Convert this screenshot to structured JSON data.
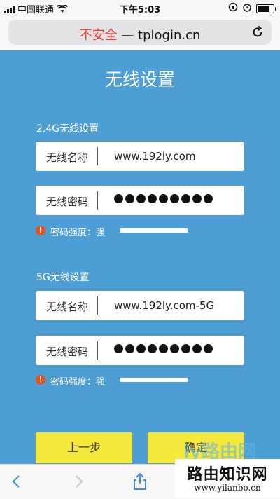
{
  "status_bar": {
    "carrier": "中国联通",
    "time": "下午5:03"
  },
  "url_bar": {
    "insecure_label": "不安全",
    "separator": "—",
    "domain": "tplogin.cn"
  },
  "page": {
    "title": "无线设置",
    "band_24": {
      "heading": "2.4G无线设置",
      "name_label": "无线名称",
      "name_value": "www.192ly.com",
      "password_label": "无线密码",
      "password_mask_count": 9,
      "strength_text": "密码强度：强"
    },
    "band_5": {
      "heading": "5G无线设置",
      "name_label": "无线名称",
      "name_value": "www.192ly.com-5G",
      "password_label": "无线密码",
      "password_mask_count": 9,
      "strength_text": "密码强度：强"
    },
    "prev_button": "上一步",
    "confirm_button": "确定"
  },
  "watermark": {
    "title": "路由知识网",
    "url": "www.yilanbo.cn",
    "faint": "ly路由网"
  },
  "colors": {
    "page_bg": "#4d9ed4",
    "button_yellow": "#f4e93a",
    "insecure_red": "#e8423a",
    "warning_orange": "#e8501e"
  },
  "icons": [
    "signal-icon",
    "wifi-icon",
    "lock-rotation-icon",
    "alarm-icon",
    "battery-icon",
    "reload-icon",
    "warning-icon",
    "back-icon",
    "forward-icon",
    "share-icon"
  ]
}
